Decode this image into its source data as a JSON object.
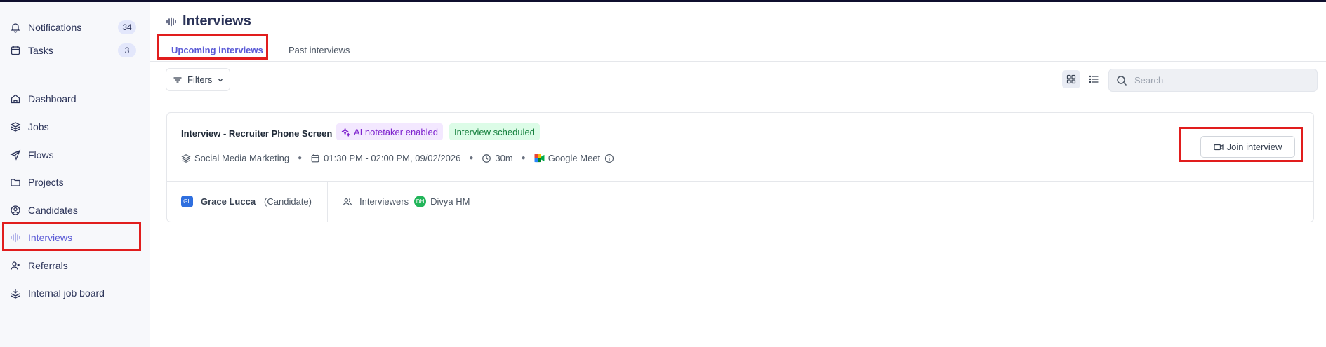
{
  "sidebar": {
    "items": [
      {
        "label": "Notifications",
        "badge": "34"
      },
      {
        "label": "Tasks",
        "badge": "3"
      },
      {
        "label": "Dashboard"
      },
      {
        "label": "Jobs"
      },
      {
        "label": "Flows"
      },
      {
        "label": "Projects"
      },
      {
        "label": "Candidates"
      },
      {
        "label": "Interviews"
      },
      {
        "label": "Referrals"
      },
      {
        "label": "Internal job board"
      }
    ]
  },
  "header": {
    "title": "Interviews"
  },
  "tabs": [
    {
      "label": "Upcoming interviews",
      "active": true
    },
    {
      "label": "Past interviews",
      "active": false
    }
  ],
  "toolbar": {
    "filters_label": "Filters",
    "search_placeholder": "Search",
    "search_value": ""
  },
  "interview": {
    "title": "Interview - Recruiter Phone Screen",
    "ai_badge": "AI notetaker enabled",
    "status_badge": "Interview scheduled",
    "job": "Social Media Marketing",
    "time": "01:30 PM - 02:00 PM, 09/02/2026",
    "duration": "30m",
    "platform": "Google Meet",
    "join_label": "Join interview",
    "candidate": {
      "initials": "GL",
      "name": "Grace Lucca",
      "role": "(Candidate)"
    },
    "interviewers_label": "Interviewers",
    "interviewer": {
      "initials": "DH",
      "name": "Divya HM"
    }
  },
  "colors": {
    "accent": "#5b5bd6",
    "highlight_box": "#e11d1d",
    "ai_badge_bg": "#f3e8ff",
    "status_badge_bg": "#dcfce7",
    "candidate_avatar": "#2f6fdf",
    "interviewer_avatar": "#22b55a"
  }
}
